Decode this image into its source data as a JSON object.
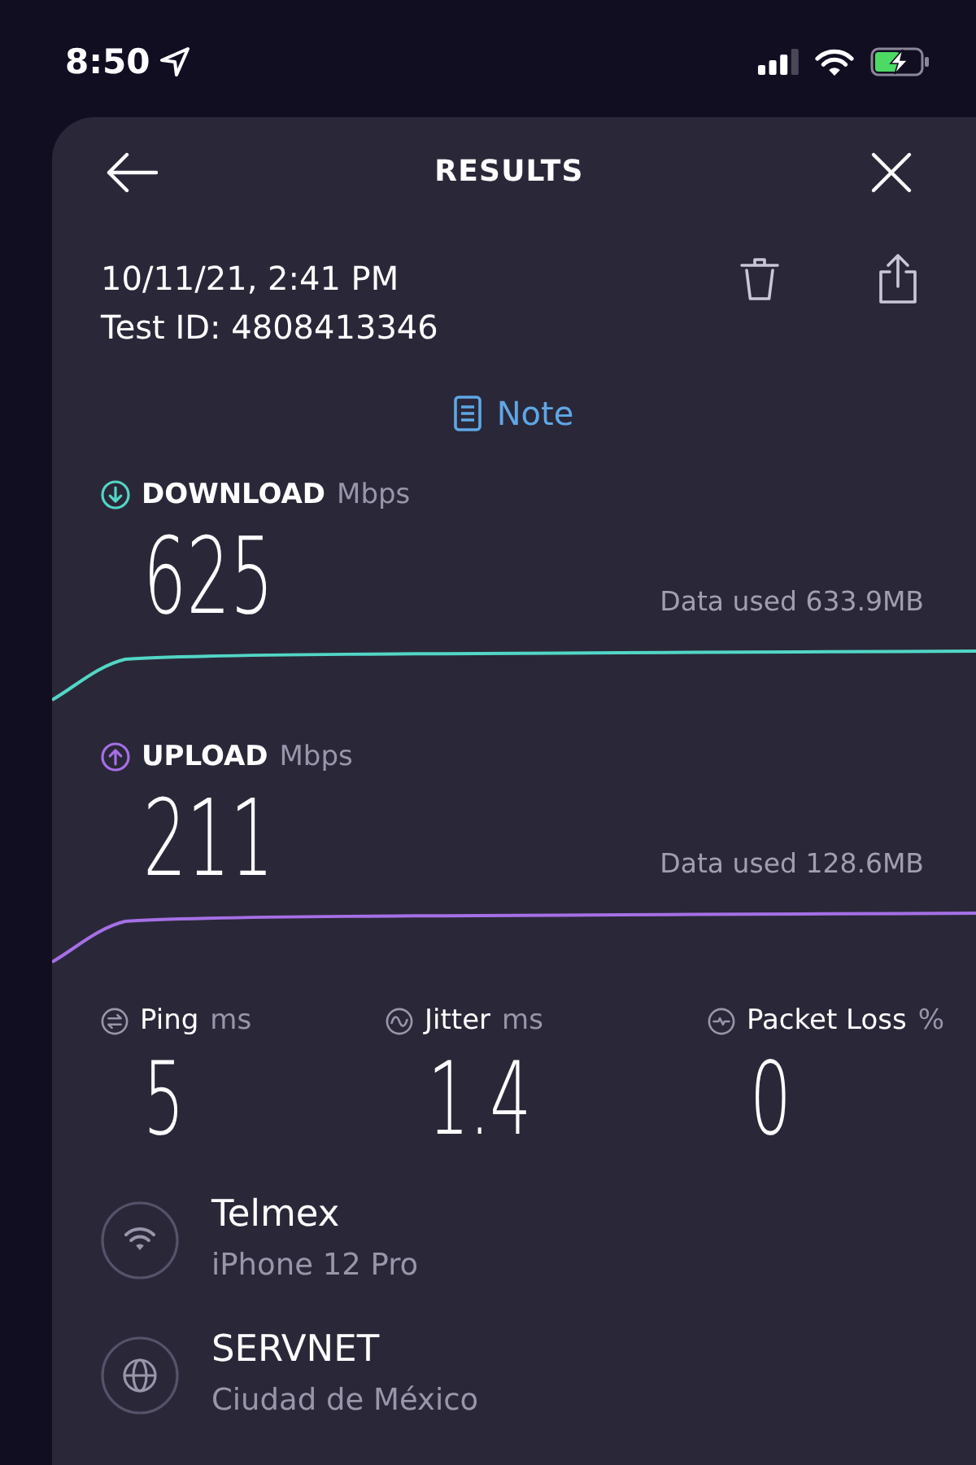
{
  "status_bar": {
    "time": "8:50"
  },
  "header": {
    "title": "RESULTS"
  },
  "test": {
    "date": "10/11/21, 2:41 PM",
    "test_id": "Test ID: 4808413346"
  },
  "note": {
    "label": "Note"
  },
  "speeds": [
    {
      "kind": "download",
      "label": "DOWNLOAD",
      "unit": "Mbps",
      "value": "625",
      "data_used": "Data used 633.9MB",
      "color": "#52d6c6"
    },
    {
      "kind": "upload",
      "label": "UPLOAD",
      "unit": "Mbps",
      "value": "211",
      "data_used": "Data used 128.6MB",
      "color": "#a66fe6"
    }
  ],
  "metrics": [
    {
      "kind": "ping",
      "label": "Ping",
      "unit": "ms",
      "value": "5"
    },
    {
      "kind": "jitter",
      "label": "Jitter",
      "unit": "ms",
      "value": "1.4"
    },
    {
      "kind": "packet_loss",
      "label": "Packet Loss",
      "unit": "%",
      "value": "0"
    }
  ],
  "connections": [
    {
      "kind": "network",
      "name": "Telmex",
      "detail": "iPhone 12 Pro"
    },
    {
      "kind": "server",
      "name": "SERVNET",
      "detail": "Ciudad de México"
    }
  ]
}
